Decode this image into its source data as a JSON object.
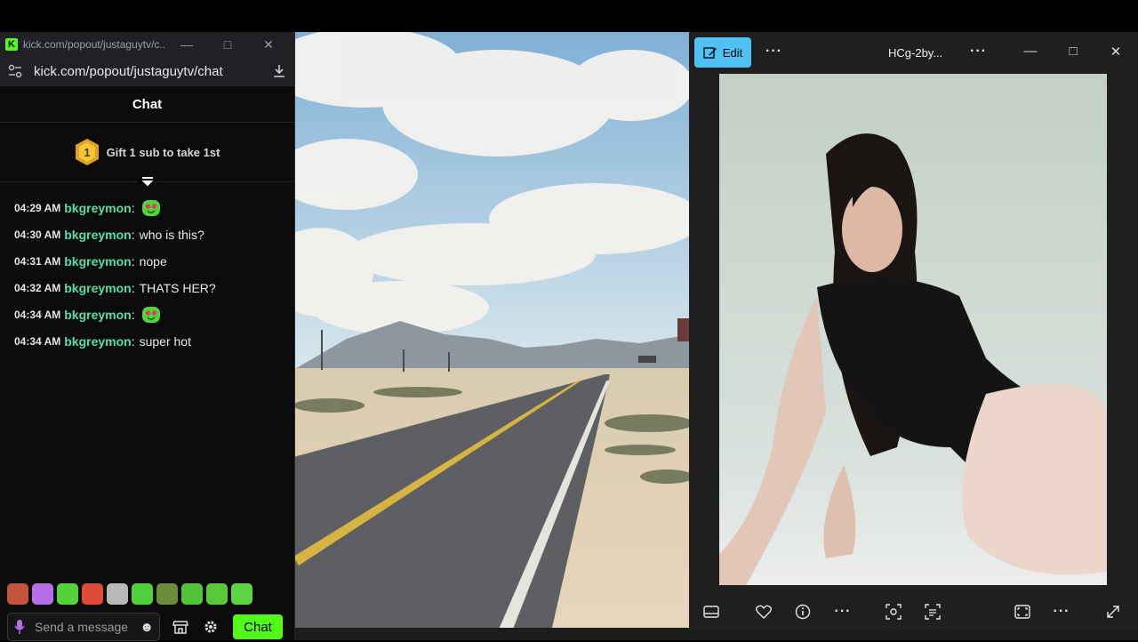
{
  "chat_window": {
    "tab_title": "kick.com/popout/justaguytv/c...",
    "url": "kick.com/popout/justaguytv/chat",
    "header": "Chat",
    "gift_text": "Gift 1 sub to take 1st",
    "gift_badge": "1",
    "messages": [
      {
        "time": "04:29 AM",
        "user": "bkgreymon",
        "text": "",
        "emote": true
      },
      {
        "time": "04:30 AM",
        "user": "bkgreymon",
        "text": "who is this?",
        "emote": false
      },
      {
        "time": "04:31 AM",
        "user": "bkgreymon",
        "text": "nope",
        "emote": false
      },
      {
        "time": "04:32 AM",
        "user": "bkgreymon",
        "text": "THATS HER?",
        "emote": false
      },
      {
        "time": "04:34 AM",
        "user": "bkgreymon",
        "text": "",
        "emote": true
      },
      {
        "time": "04:34 AM",
        "user": "bkgreymon",
        "text": "super hot",
        "emote": false
      }
    ],
    "input_placeholder": "Send a message",
    "chat_button": "Chat",
    "emote_colors": [
      "#c0533a",
      "#b36ee8",
      "#53d23a",
      "#e04a3a",
      "#b9b9b9",
      "#4fd13a",
      "#6b8e3a",
      "#52c23a",
      "#58c93a",
      "#5bd640"
    ]
  },
  "viewer": {
    "edit_label": "Edit",
    "file_name": "HCg-2by..."
  },
  "colors": {
    "kick_green": "#53fc18",
    "username": "#53e0a5",
    "edit_blue": "#4fc1f5"
  }
}
